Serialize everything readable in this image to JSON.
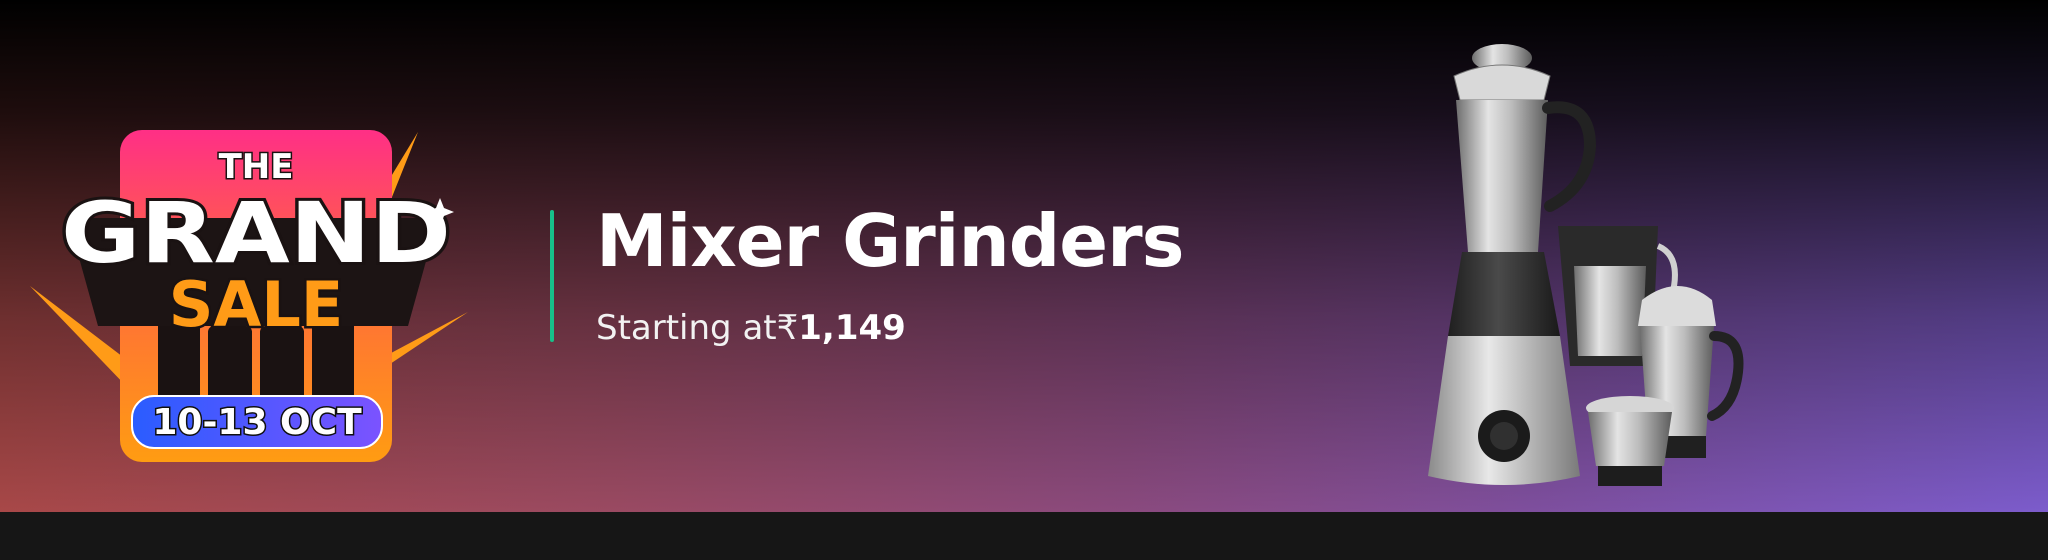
{
  "banner": {
    "logo": {
      "line1": "THE",
      "line2": "GRAND",
      "line3": "SALE",
      "dates": "10-13 OCT"
    },
    "title": "Mixer Grinders",
    "subtitle_prefix": "Starting at",
    "currency": "₹",
    "price": "1,149",
    "product_icon": "mixer-grinder-image",
    "colors": {
      "accent_divider": "#17c08a",
      "logo_orange": "#ff9518",
      "logo_pink": "#ff2d88",
      "dates_blue": "#2f6fff"
    }
  }
}
